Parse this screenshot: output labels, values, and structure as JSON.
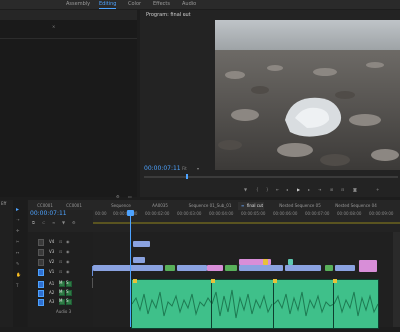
{
  "workspaces": [
    "Assembly",
    "Editing",
    "Color",
    "Effects",
    "Audio"
  ],
  "active_workspace": "Editing",
  "program_monitor": {
    "title": "Program: final cut",
    "timecode": "00:00:07:11",
    "zoom": "Fit",
    "right_readout": "1/2"
  },
  "timeline": {
    "tabs": [
      "CC0001",
      "CC0001",
      "Sequence 01",
      "AA0035",
      "Sequence 01_Sub_01",
      "final cut",
      "Nested Sequence 05",
      "Nested Sequence 04"
    ],
    "active_tab": "final cut",
    "timecode": "00:00:07:11",
    "ruler": [
      "00:00",
      "00:00:01:00",
      "00:00:02:00",
      "00:00:03:00",
      "00:00:04:00",
      "00:00:05:00",
      "00:00:06:00",
      "00:00:07:00",
      "00:00:08:00",
      "00:00:09:00"
    ],
    "tracks_video": [
      "V4",
      "V3",
      "V2",
      "V1"
    ],
    "tracks_audio": [
      "A1",
      "A2",
      "A3"
    ],
    "audio_label": "Audio 3",
    "track_letters": [
      "M",
      "S",
      "M",
      "S",
      "M",
      "S"
    ],
    "clip_label_v1": "VP1 Rem wp",
    "clip_label_a": "fx"
  },
  "left_panel_label": "Eff"
}
